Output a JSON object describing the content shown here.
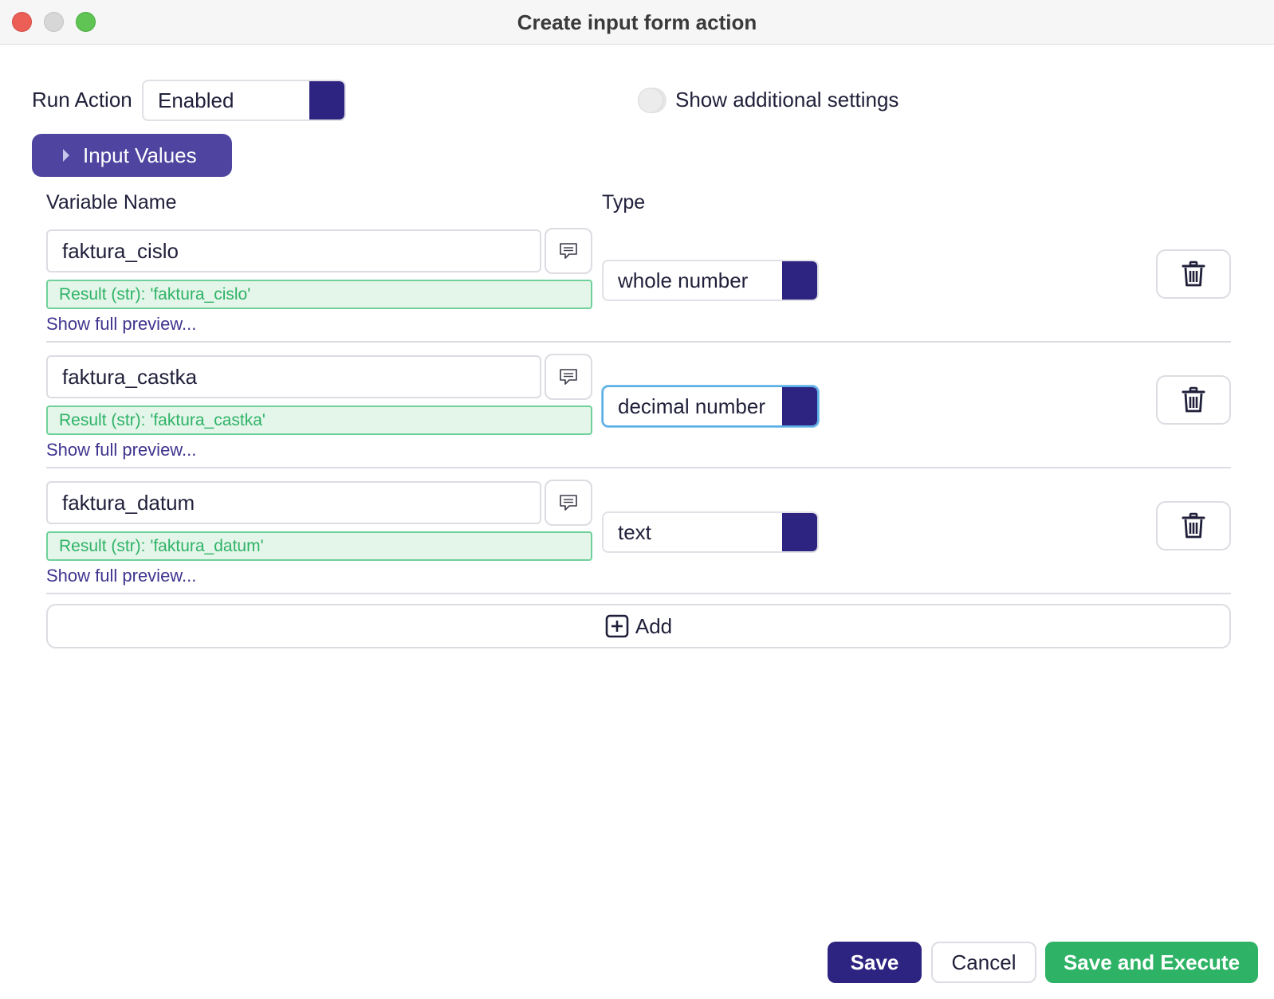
{
  "window": {
    "title": "Create input form action"
  },
  "run_action": {
    "label": "Run Action",
    "value": "Enabled"
  },
  "additional_settings": {
    "label": "Show additional settings",
    "enabled": false
  },
  "section": {
    "label": "Input Values"
  },
  "columns": {
    "variable_name": "Variable Name",
    "type": "Type"
  },
  "rows": [
    {
      "name": "faktura_cislo",
      "result": "Result (str): 'faktura_cislo'",
      "preview": "Show full preview...",
      "type": "whole number"
    },
    {
      "name": "faktura_castka",
      "result": "Result (str): 'faktura_castka'",
      "preview": "Show full preview...",
      "type": "decimal number"
    },
    {
      "name": "faktura_datum",
      "result": "Result (str): 'faktura_datum'",
      "preview": "Show full preview...",
      "type": "text"
    }
  ],
  "add": {
    "label": "Add",
    "icon": "plus-square-icon"
  },
  "footer": {
    "save": "Save",
    "cancel": "Cancel",
    "save_execute": "Save and Execute"
  },
  "colors": {
    "primary": "#2d2380",
    "section": "#4f44a0",
    "success": "#2eb366",
    "link": "#3e348f"
  }
}
